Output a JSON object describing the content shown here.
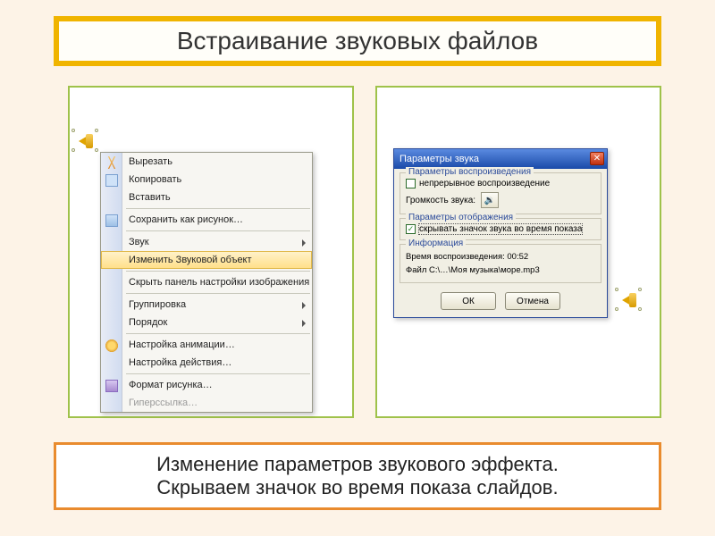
{
  "title": "Встраивание звуковых файлов",
  "caption_line1": "Изменение параметров звукового эффекта.",
  "caption_line2": "Скрываем значок во время показа слайдов.",
  "context_menu": {
    "cut": "Вырезать",
    "copy": "Копировать",
    "paste": "Вставить",
    "save_as_pic": "Сохранить как рисунок…",
    "sound": "Звук",
    "edit_sound": "Изменить Звуковой объект",
    "hide_toolbar": "Скрыть панель настройки изображения",
    "group": "Группировка",
    "order": "Порядок",
    "anim": "Настройка анимации…",
    "action": "Настройка действия…",
    "format": "Формат рисунка…",
    "hyperlink": "Гиперссылка…"
  },
  "dialog": {
    "title": "Параметры звука",
    "group_play": "Параметры воспроизведения",
    "loop": "непрерывное воспроизведение",
    "volume_label": "Громкость звука:",
    "group_display": "Параметры отображения",
    "hide_icon": "скрывать значок звука во время показа",
    "group_info": "Информация",
    "info_time": "Время воспроизведения:  00:52",
    "info_file": "Файл   C:\\…\\Моя музыка\\море.mp3",
    "ok": "ОК",
    "cancel": "Отмена"
  }
}
